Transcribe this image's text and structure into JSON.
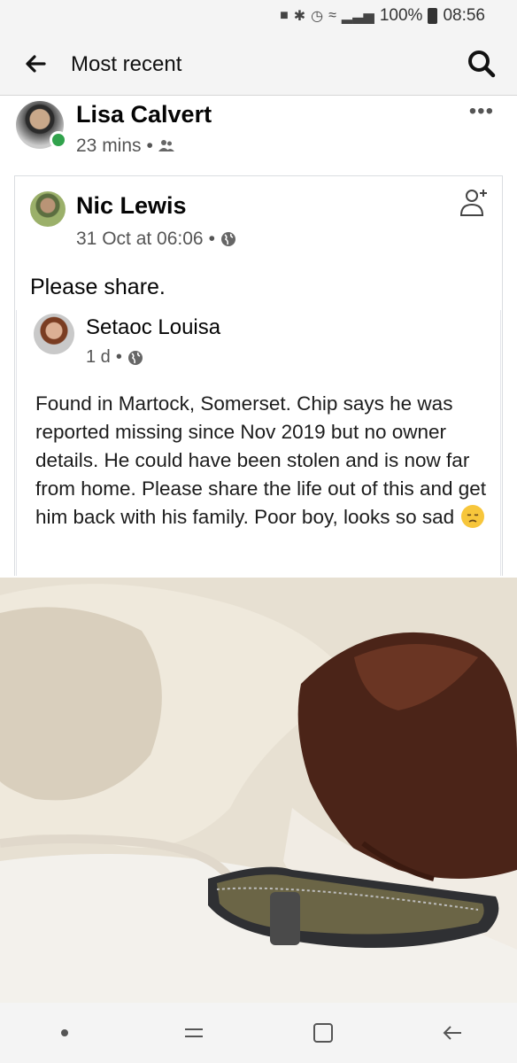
{
  "status_bar": {
    "battery": "100%",
    "time": "08:56",
    "icons": [
      "sim-icon",
      "bluetooth-icon",
      "alarm-icon",
      "wifi-icon",
      "signal-icon",
      "battery-icon"
    ]
  },
  "top_bar": {
    "title": "Most recent",
    "back_icon": "arrow-left-icon",
    "search_icon": "search-icon"
  },
  "post": {
    "author": "Lisa Calvert",
    "time": "23 mins",
    "audience_icon": "friends-icon",
    "more_icon": "more-horizontal-icon",
    "more_label": "•••",
    "online": true
  },
  "shared_post": {
    "author": "Nic Lewis",
    "time": "31 Oct at 06:06",
    "audience_icon": "globe-icon",
    "text": "Please share.",
    "add_friend_icon": "add-friend-icon"
  },
  "original_post": {
    "author": "Setaoc Louisa",
    "time": "1 d",
    "audience_icon": "globe-icon",
    "text": "Found in Martock, Somerset. Chip says he was reported missing since Nov 2019 but no owner details. He could have been stolen and is now far from home. Please share the life out of this and get him back with his family. Poor boy, looks so sad",
    "emoji": "disappointed-face-emoji"
  },
  "nav_bar": {
    "buttons": [
      "dot-icon",
      "recents-icon",
      "home-icon",
      "back-nav-icon"
    ]
  }
}
